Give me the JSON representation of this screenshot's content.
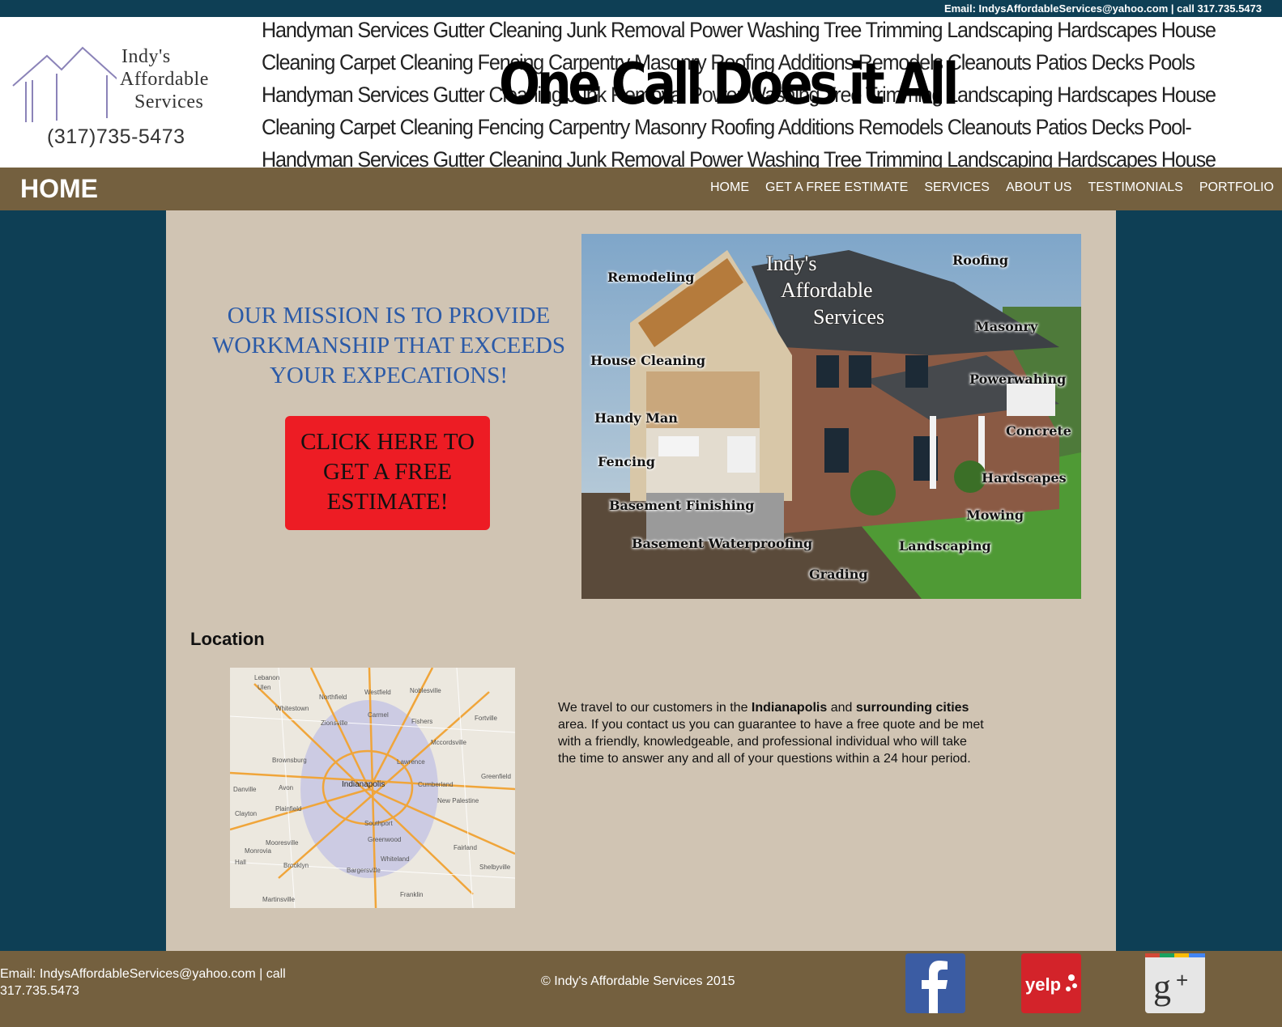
{
  "topbar": {
    "contact": "Email: IndysAffordableServices@yahoo.com | call 317.735.5473"
  },
  "header": {
    "logo": {
      "line1": "Indy's",
      "line2": "Affordable",
      "line3": "Services",
      "phone": "(317)735-5473"
    },
    "service_lines": [
      "Handyman Services Gutter Cleaning Junk Removal Power Washing Tree Trimming Landscaping Hardscapes House",
      "Cleaning Carpet Cleaning Fencing Carpentry Masonry Roofing Additions Remodels Cleanouts Patios Decks Pools",
      "Handyman Services Gutter Cleaning Junk Removal Power Washing Tree Trimming Landscaping Hardscapes House",
      "Cleaning Carpet Cleaning Fencing Carpentry Masonry Roofing Additions Remodels Cleanouts Patios Decks Pool-",
      "Handyman Services Gutter Cleaning Junk Removal Power Washing Tree Trimming Landscaping Hardscapes House"
    ],
    "tagline": "One Call Does it All"
  },
  "nav": {
    "page_title": "HOME",
    "links": [
      "HOME",
      "GET A FREE ESTIMATE",
      "SERVICES",
      "ABOUT US",
      "TESTIMONIALS",
      "PORTFOLIO"
    ]
  },
  "main": {
    "mission": "OUR MISSION IS TO PROVIDE WORKMANSHIP THAT EXCEEDS YOUR EXPECATIONS!",
    "cta": "CLICK HERE TO GET A FREE ESTIMATE!",
    "hero": {
      "brand": [
        "Indy's",
        "Affordable",
        "Services"
      ],
      "labels": [
        "Remodeling",
        "Roofing",
        "Masonry",
        "House Cleaning",
        "Powerwahing",
        "Handy Man",
        "Concrete",
        "Fencing",
        "Hardscapes",
        "Basement Finishing",
        "Mowing",
        "Basement Waterproofing",
        "Landscaping",
        "Grading"
      ]
    },
    "location": {
      "title": "Location",
      "map_city": "Indianapolis",
      "map_towns": [
        "Northfield",
        "Westfield",
        "Noblesville",
        "Carmel",
        "Fishers",
        "Zionsville",
        "Brownsburg",
        "Lawrence",
        "Avon",
        "Plainfield",
        "Danville",
        "Cumberland",
        "Greenwood",
        "Mooresville",
        "Whiteland",
        "Franklin",
        "Southport",
        "Greenfield",
        "New Palestine",
        "Fairland",
        "Shelbyville",
        "Martinsville",
        "Bargersville",
        "Mccordsville",
        "Fortville",
        "Clayton",
        "Monrovia",
        "Brooklyn",
        "Hall",
        "Lebanon",
        "Ulen",
        "Whitestown"
      ],
      "text_parts": [
        "We travel to our customers in the ",
        "Indianapolis",
        " and ",
        "surrounding cities",
        " area. If you contact us you can guarantee to have a free quote and be met with a friendly, knowledgeable, and professional individual who will take the time to answer any and all of your questions within a 24 hour period."
      ]
    }
  },
  "footer": {
    "contact": "Email: IndysAffordableServices@yahoo.com | call 317.735.5473",
    "copyright": "© Indy's Affordable Services 2015",
    "social": [
      "facebook-icon",
      "yelp-icon",
      "google-plus-icon"
    ],
    "colors": {
      "facebook": "#3b5ca3",
      "yelp": "#d3232a",
      "google_plus": "#e6e6e6"
    }
  }
}
